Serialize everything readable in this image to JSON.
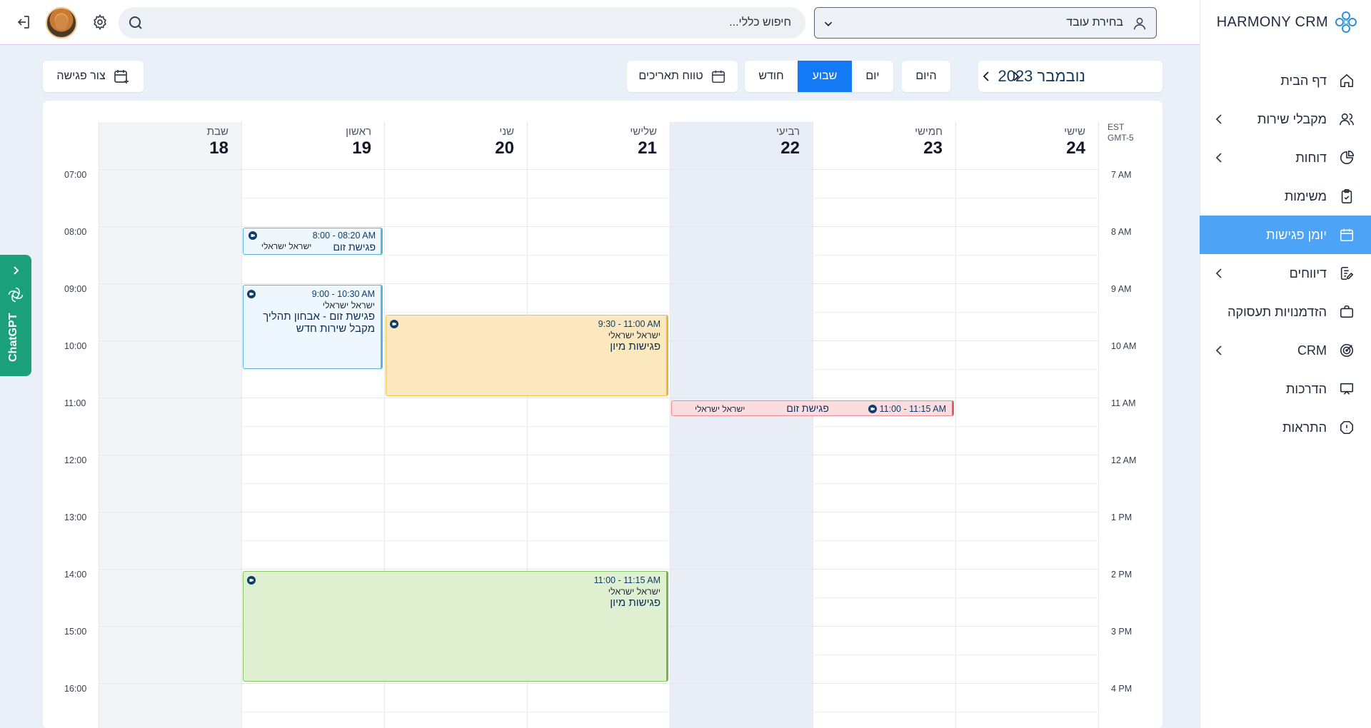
{
  "app": {
    "brand": "HARMONY CRM"
  },
  "sidebar": {
    "items": [
      {
        "label": "דף הבית",
        "icon": "home-icon",
        "chevron": false,
        "active": false
      },
      {
        "label": "מקבלי שירות",
        "icon": "users-icon",
        "chevron": true,
        "active": false
      },
      {
        "label": "דוחות",
        "icon": "pie-chart-icon",
        "chevron": true,
        "active": false
      },
      {
        "label": "משימות",
        "icon": "clipboard-check-icon",
        "chevron": false,
        "active": false
      },
      {
        "label": "יומן פגישות",
        "icon": "calendar-icon",
        "chevron": false,
        "active": true
      },
      {
        "label": "דיווחים",
        "icon": "report-edit-icon",
        "chevron": true,
        "active": false
      },
      {
        "label": "הזדמנויות תעסוקה",
        "icon": "briefcase-icon",
        "chevron": false,
        "active": false
      },
      {
        "label": "CRM",
        "icon": "target-icon",
        "chevron": true,
        "active": false
      },
      {
        "label": "הדרכות",
        "icon": "presentation-icon",
        "chevron": false,
        "active": false
      },
      {
        "label": "התראות",
        "icon": "alert-icon",
        "chevron": false,
        "active": false
      }
    ]
  },
  "topbar": {
    "employee_select": "בחירת עובד",
    "search_placeholder": "חיפוש כללי..."
  },
  "toolbar": {
    "month_title": "נובמבר 2023",
    "today": "היום",
    "views": {
      "day": "יום",
      "week": "שבוע",
      "month": "חודש",
      "active": "week"
    },
    "date_range": "טווח תאריכים",
    "create_meeting": "צור פגישה"
  },
  "calendar": {
    "timezone": [
      "EST",
      "GMT-5"
    ],
    "days": [
      {
        "name": "שישי",
        "num": "24"
      },
      {
        "name": "חמישי",
        "num": "23"
      },
      {
        "name": "רביעי",
        "num": "22",
        "today": true
      },
      {
        "name": "שלישי",
        "num": "21"
      },
      {
        "name": "שני",
        "num": "20"
      },
      {
        "name": "ראשון",
        "num": "19"
      },
      {
        "name": "שבת",
        "num": "18",
        "weekend": true
      }
    ],
    "hours_24": [
      "07:00",
      "08:00",
      "09:00",
      "10:00",
      "11:00",
      "12:00",
      "13:00",
      "14:00",
      "15:00",
      "16:00"
    ],
    "hours_12": [
      "7 AM",
      "8 AM",
      "9 AM",
      "10 AM",
      "11 AM",
      "12 AM",
      "1 PM",
      "2 PM",
      "3 PM",
      "4 PM"
    ],
    "events": [
      {
        "time": "8:00 - 08:20 AM",
        "title": "פגישת זום",
        "person": "ישראל ישראלי",
        "color": "blue"
      },
      {
        "time": "9:00 - 10:30 AM",
        "person": "ישראל ישראלי",
        "title": "פגישת זום - אבחון תהליך מקבל שירות חדש",
        "color": "blue"
      },
      {
        "time": "9:30 - 11:00 AM",
        "person": "ישראל ישראלי",
        "title": "פגישות מיון",
        "color": "yellow"
      },
      {
        "time": "11:00 - 11:15 AM",
        "title": "פגישת זום",
        "person": "ישראל ישראלי",
        "color": "red"
      },
      {
        "time": "11:00 - 11:15 AM",
        "person": "ישראל ישראלי",
        "title": "פגישות מיון",
        "color": "green"
      }
    ]
  },
  "chatgpt_tab": {
    "label": "ChatGPT"
  }
}
